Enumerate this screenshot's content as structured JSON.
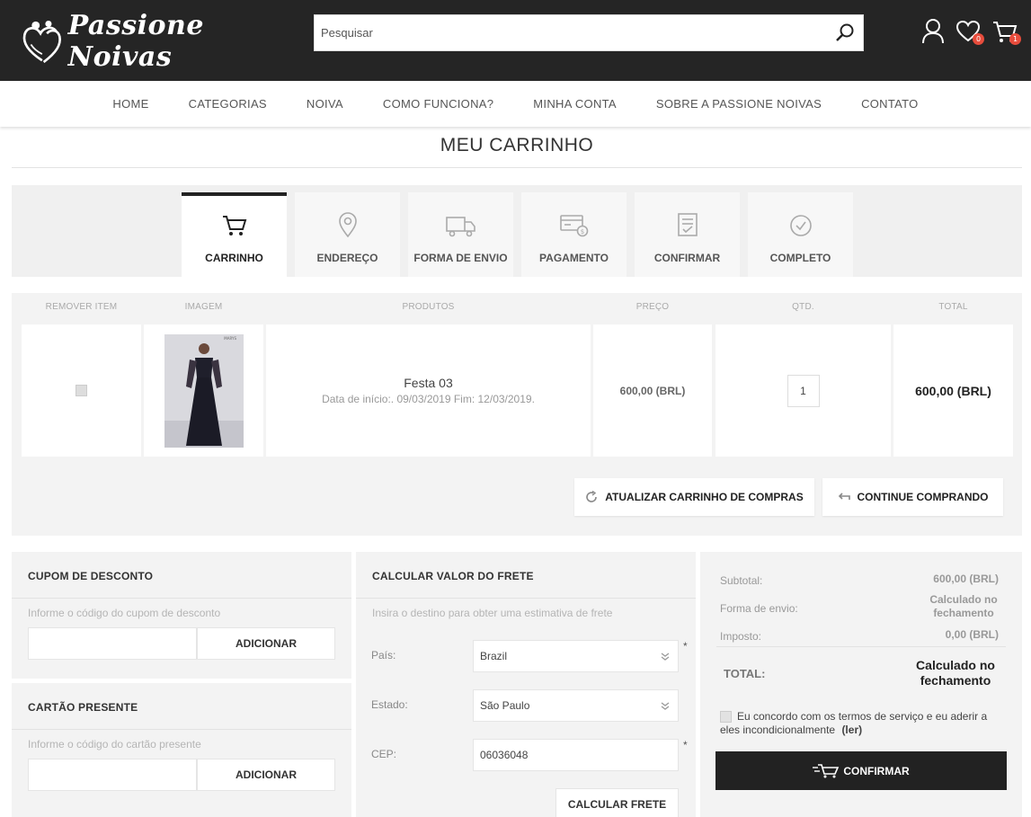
{
  "header": {
    "brand": "Passione Noivas",
    "search_placeholder": "Pesquisar",
    "wishlist_count": "0",
    "cart_count": "1"
  },
  "nav": {
    "items": [
      "HOME",
      "CATEGORIAS",
      "NOIVA",
      "COMO FUNCIONA?",
      "MINHA CONTA",
      "SOBRE A PASSIONE NOIVAS",
      "CONTATO"
    ]
  },
  "page_title": "MEU CARRINHO",
  "steps": [
    {
      "label": "CARRINHO",
      "icon": "cart-icon",
      "active": true
    },
    {
      "label": "ENDEREÇO",
      "icon": "location-pin-icon",
      "active": false
    },
    {
      "label": "FORMA DE ENVIO",
      "icon": "truck-icon",
      "active": false
    },
    {
      "label": "PAGAMENTO",
      "icon": "payment-card-icon",
      "active": false
    },
    {
      "label": "CONFIRMAR",
      "icon": "checklist-icon",
      "active": false
    },
    {
      "label": "COMPLETO",
      "icon": "check-circle-icon",
      "active": false
    }
  ],
  "cart_table": {
    "headers": {
      "remove": "REMOVER ITEM",
      "image": "IMAGEM",
      "products": "PRODUTOS",
      "price": "PREÇO",
      "qty": "QTD.",
      "total": "TOTAL"
    },
    "items": [
      {
        "name": "Festa 03",
        "dates": "Data de início:. 09/03/2019 Fim: 12/03/2019.",
        "price": "600,00 (BRL)",
        "qty": "1",
        "total": "600,00 (BRL)"
      }
    ]
  },
  "cart_actions": {
    "update": "ATUALIZAR CARRINHO DE COMPRAS",
    "continue": "CONTINUE COMPRANDO"
  },
  "coupon": {
    "title": "CUPOM DE DESCONTO",
    "hint": "Informe o código do cupom de desconto",
    "button": "ADICIONAR"
  },
  "gift_card": {
    "title": "CARTÃO PRESENTE",
    "hint": "Informe o código do cartão presente",
    "button": "ADICIONAR"
  },
  "shipping": {
    "title": "CALCULAR VALOR DO FRETE",
    "hint": "Insira o destino para obter uma estimativa de frete",
    "country_label": "País:",
    "country_value": "Brazil",
    "state_label": "Estado:",
    "state_value": "São Paulo",
    "zip_label": "CEP:",
    "zip_value": "06036048",
    "required_mark": "*",
    "button": "CALCULAR FRETE"
  },
  "summary": {
    "subtotal_label": "Subtotal:",
    "subtotal_value": "600,00 (BRL)",
    "shipping_label": "Forma de envio:",
    "shipping_value": "Calculado no fechamento",
    "tax_label": "Imposto:",
    "tax_value": "0,00 (BRL)",
    "total_label": "TOTAL:",
    "total_value": "Calculado no fechamento",
    "terms_text": "Eu concordo com os termos de serviço e eu aderir a eles incondicionalmente",
    "terms_link": "(ler)",
    "confirm_button": "CONFIRMAR"
  }
}
